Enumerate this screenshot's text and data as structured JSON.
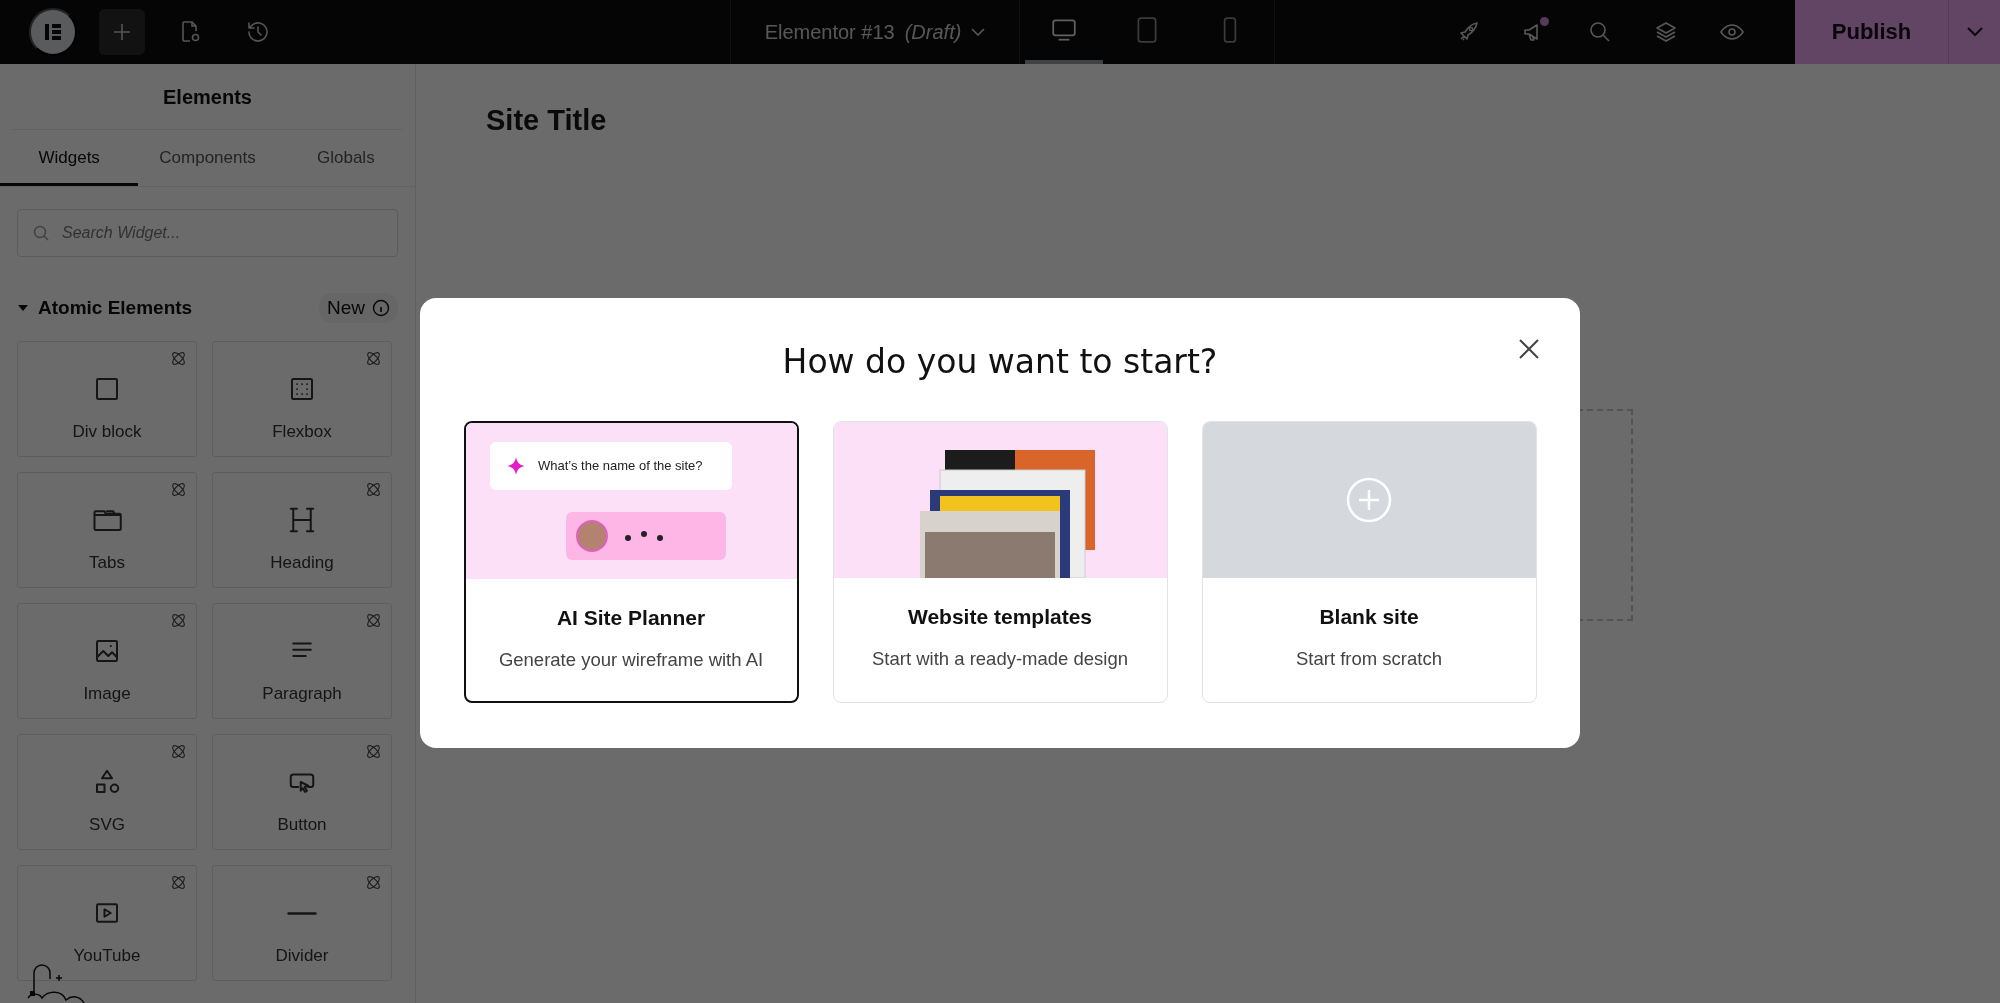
{
  "top_bar": {
    "document_title": "Elementor #13",
    "document_status": "(Draft)",
    "devices": [
      {
        "kind": "desktop",
        "selected": true
      },
      {
        "kind": "tablet",
        "selected": false
      },
      {
        "kind": "mobile",
        "selected": false
      }
    ],
    "has_notification": true,
    "publish_button": "Publish"
  },
  "sidebar": {
    "title": "Elements",
    "tabs": [
      {
        "label": "Widgets",
        "selected": true
      },
      {
        "label": "Components",
        "selected": false
      },
      {
        "label": "Globals",
        "selected": false
      }
    ],
    "search": {
      "placeholder": "Search Widget..."
    },
    "category": {
      "title": "Atomic Elements",
      "expanded": true,
      "badge": "New"
    },
    "widgets": [
      {
        "label": "Div block",
        "kind": "div"
      },
      {
        "label": "Flexbox",
        "kind": "flexbox"
      },
      {
        "label": "Tabs",
        "kind": "tabs"
      },
      {
        "label": "Heading",
        "kind": "heading"
      },
      {
        "label": "Image",
        "kind": "image"
      },
      {
        "label": "Paragraph",
        "kind": "paragraph"
      },
      {
        "label": "SVG",
        "kind": "svg"
      },
      {
        "label": "Button",
        "kind": "button"
      },
      {
        "label": "YouTube",
        "kind": "youtube"
      },
      {
        "label": "Divider",
        "kind": "divider"
      }
    ]
  },
  "canvas": {
    "site_title": "Site Title"
  },
  "modal": {
    "title": "How do you want to start?",
    "options": [
      {
        "kind": "ai",
        "title": "AI Site Planner",
        "subtitle": "Generate your wireframe with AI",
        "selected": true,
        "prompt": "What’s the name of the site?"
      },
      {
        "kind": "templates",
        "title": "Website templates",
        "subtitle": "Start with a ready-made design",
        "selected": false
      },
      {
        "kind": "blank",
        "title": "Blank site",
        "subtitle": "Start from scratch",
        "selected": false
      }
    ]
  }
}
